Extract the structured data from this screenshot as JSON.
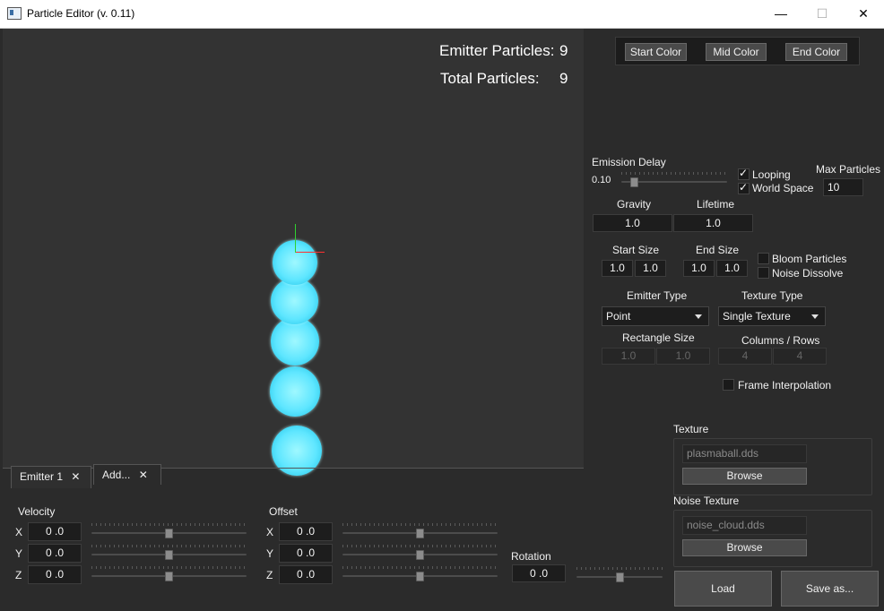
{
  "window": {
    "title": "Particle Editor (v. 0.11)",
    "minimize": "—",
    "maximize": "☐",
    "close": "✕"
  },
  "stats": {
    "emitter_label": "Emitter Particles:",
    "emitter_value": "9",
    "total_label": "Total Particles:",
    "total_value": "9"
  },
  "colors": {
    "start": "Start Color",
    "mid": "Mid Color",
    "end": "End Color"
  },
  "emission": {
    "label": "Emission Delay",
    "value": "0.10",
    "slider_fraction": 0.1
  },
  "looping": {
    "label": "Looping",
    "checked": true
  },
  "world_space": {
    "label": "World Space",
    "checked": true
  },
  "max_particles": {
    "label": "Max Particles",
    "value": "10"
  },
  "gravity": {
    "label": "Gravity",
    "value": "1.0"
  },
  "lifetime": {
    "label": "Lifetime",
    "value": "1.0"
  },
  "start_size": {
    "label": "Start Size",
    "a": "1.0",
    "b": "1.0"
  },
  "end_size": {
    "label": "End Size",
    "a": "1.0",
    "b": "1.0"
  },
  "bloom": {
    "label": "Bloom Particles",
    "checked": false
  },
  "noise_dissolve": {
    "label": "Noise Dissolve",
    "checked": false
  },
  "emitter_type": {
    "label": "Emitter Type",
    "value": "Point"
  },
  "texture_type": {
    "label": "Texture Type",
    "value": "Single Texture"
  },
  "rect_size": {
    "label": "Rectangle Size",
    "a": "1.0",
    "b": "1.0"
  },
  "cols_rows": {
    "label": "Columns / Rows",
    "a": "4",
    "b": "4"
  },
  "frame_interp": {
    "label": "Frame Interpolation",
    "checked": false
  },
  "texture": {
    "label": "Texture",
    "file": "plasmaball.dds",
    "browse": "Browse"
  },
  "noise_texture": {
    "label": "Noise Texture",
    "file": "noise_cloud.dds",
    "browse": "Browse"
  },
  "actions": {
    "load": "Load",
    "save": "Save as..."
  },
  "tabs": [
    {
      "label": "Emitter 1"
    },
    {
      "label": "Add..."
    }
  ],
  "velocity": {
    "label": "Velocity",
    "x": "0 .0",
    "y": "0 .0",
    "z": "0 .0"
  },
  "offset": {
    "label": "Offset",
    "x": "0 .0",
    "y": "0 .0",
    "z": "0 .0"
  },
  "rotation": {
    "label": "Rotation",
    "value": "0 .0"
  },
  "axes": {
    "x": "X",
    "y": "Y",
    "z": "Z"
  },
  "accent": {
    "particle": "#5ee6ff",
    "gizmo_x": "#ff3030",
    "gizmo_y": "#30d030"
  }
}
